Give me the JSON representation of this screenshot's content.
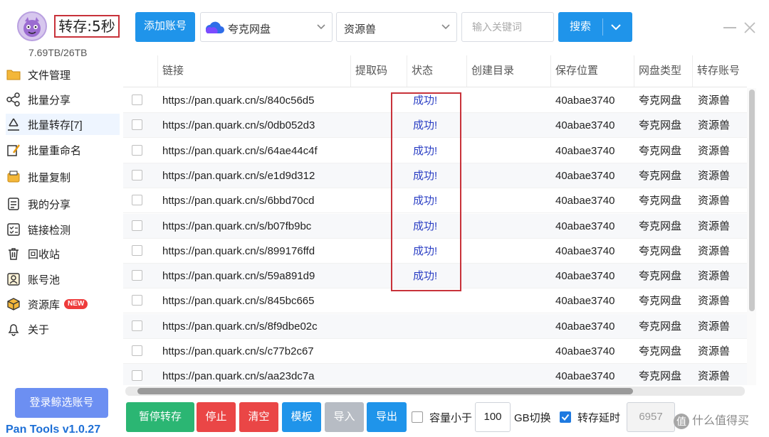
{
  "header": {
    "transfer_timer": "转存:5秒",
    "storage": "7.69TB/26TB"
  },
  "toolbar": {
    "add_account_label": "添加账号",
    "disk_type": "夸克网盘",
    "account": "资源兽",
    "keyword_placeholder": "输入关键词",
    "search_label": "搜索"
  },
  "sidebar": {
    "items": [
      {
        "label": "文件管理",
        "icon": "folder-icon"
      },
      {
        "label": "批量分享",
        "icon": "share-icon"
      },
      {
        "label": "批量转存[7]",
        "icon": "recycle-icon"
      },
      {
        "label": "批量重命名",
        "icon": "rename-icon"
      },
      {
        "label": "批量复制",
        "icon": "copy-icon"
      },
      {
        "label": "我的分享",
        "icon": "my-share-icon"
      },
      {
        "label": "链接检测",
        "icon": "link-check-icon"
      },
      {
        "label": "回收站",
        "icon": "trash-icon"
      },
      {
        "label": "账号池",
        "icon": "account-pool-icon"
      },
      {
        "label": "资源库",
        "icon": "box-icon"
      },
      {
        "label": "关于",
        "icon": "bell-icon"
      }
    ],
    "new_badge": "NEW",
    "login_label": "登录鲸选账号",
    "version": "Pan Tools v1.0.27"
  },
  "table": {
    "columns": [
      "链接",
      "提取码",
      "状态",
      "创建目录",
      "保存位置",
      "网盘类型",
      "转存账号"
    ],
    "rows": [
      {
        "link": "https://pan.quark.cn/s/840c56d5",
        "code": "",
        "status": "成功!",
        "dir": "",
        "location": "40abae3740",
        "disk": "夸克网盘",
        "account": "资源兽"
      },
      {
        "link": "https://pan.quark.cn/s/0db052d3",
        "code": "",
        "status": "成功!",
        "dir": "",
        "location": "40abae3740",
        "disk": "夸克网盘",
        "account": "资源兽"
      },
      {
        "link": "https://pan.quark.cn/s/64ae44c4f",
        "code": "",
        "status": "成功!",
        "dir": "",
        "location": "40abae3740",
        "disk": "夸克网盘",
        "account": "资源兽"
      },
      {
        "link": "https://pan.quark.cn/s/e1d9d312",
        "code": "",
        "status": "成功!",
        "dir": "",
        "location": "40abae3740",
        "disk": "夸克网盘",
        "account": "资源兽"
      },
      {
        "link": "https://pan.quark.cn/s/6bbd70cd",
        "code": "",
        "status": "成功!",
        "dir": "",
        "location": "40abae3740",
        "disk": "夸克网盘",
        "account": "资源兽"
      },
      {
        "link": "https://pan.quark.cn/s/b07fb9bc",
        "code": "",
        "status": "成功!",
        "dir": "",
        "location": "40abae3740",
        "disk": "夸克网盘",
        "account": "资源兽"
      },
      {
        "link": "https://pan.quark.cn/s/899176ffd",
        "code": "",
        "status": "成功!",
        "dir": "",
        "location": "40abae3740",
        "disk": "夸克网盘",
        "account": "资源兽"
      },
      {
        "link": "https://pan.quark.cn/s/59a891d9",
        "code": "",
        "status": "成功!",
        "dir": "",
        "location": "40abae3740",
        "disk": "夸克网盘",
        "account": "资源兽"
      },
      {
        "link": "https://pan.quark.cn/s/845bc665",
        "code": "",
        "status": "",
        "dir": "",
        "location": "40abae3740",
        "disk": "夸克网盘",
        "account": "资源兽"
      },
      {
        "link": "https://pan.quark.cn/s/8f9dbe02c",
        "code": "",
        "status": "",
        "dir": "",
        "location": "40abae3740",
        "disk": "夸克网盘",
        "account": "资源兽"
      },
      {
        "link": "https://pan.quark.cn/s/c77b2c67",
        "code": "",
        "status": "",
        "dir": "",
        "location": "40abae3740",
        "disk": "夸克网盘",
        "account": "资源兽"
      },
      {
        "link": "https://pan.quark.cn/s/aa23dc7a",
        "code": "",
        "status": "",
        "dir": "",
        "location": "40abae3740",
        "disk": "夸克网盘",
        "account": "资源兽"
      }
    ]
  },
  "actions": {
    "pause": "暂停转存",
    "stop": "停止",
    "clear": "清空",
    "template": "模板",
    "import": "导入",
    "export": "导出",
    "capacity_label": "容量小于",
    "capacity_value": "100",
    "capacity_unit": "GB切换",
    "delay_label": "转存延时",
    "delay_value": "6957",
    "capacity_checked": false,
    "delay_checked": true
  },
  "watermark": {
    "logo_char": "值",
    "text": "什么值得买"
  },
  "colors": {
    "primary": "#1f94ea",
    "pause": "#2bb673",
    "stop": "#ea4646",
    "clear": "#ea4646",
    "template": "#1f94ea",
    "import_disabled": "#b7bcc4",
    "export": "#1f94ea",
    "status_success": "#2b3fc4",
    "highlight": "#c8323a"
  }
}
